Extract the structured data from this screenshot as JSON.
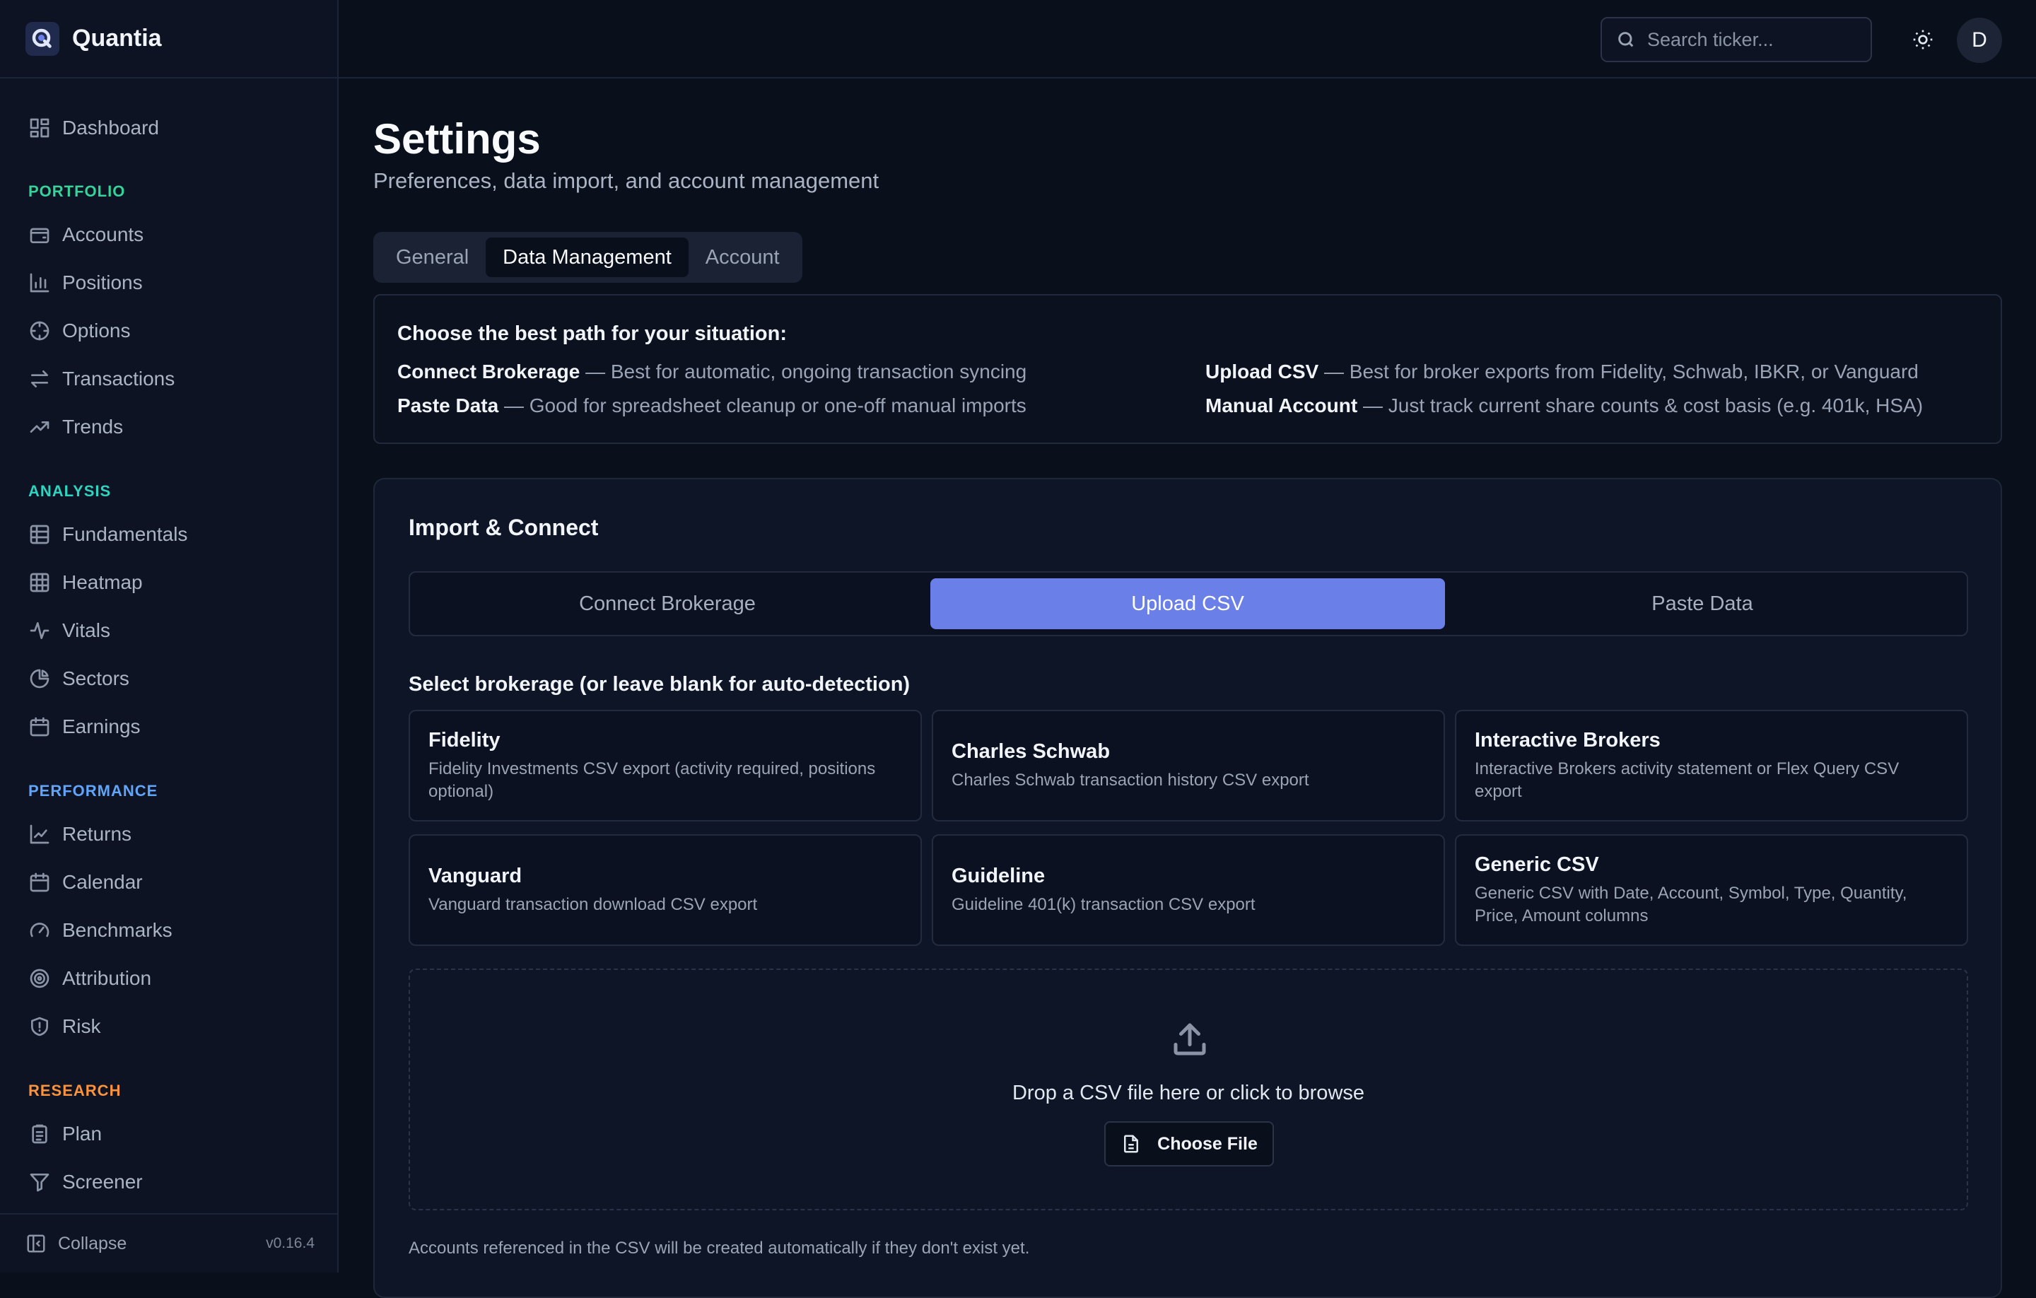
{
  "app": {
    "name": "Quantia",
    "version": "v0.16.4",
    "logo_icon": "q-logo-icon"
  },
  "colors": {
    "background": "#0a0f1c",
    "sidebar": "#0d1322",
    "accent": "#6b7fe8",
    "section_portfolio": "#34d399",
    "section_analysis": "#2dd4bf",
    "section_performance": "#60a5fa",
    "section_research": "#fb923c"
  },
  "sidebar": {
    "dashboard": "Dashboard",
    "sections": [
      {
        "label": "PORTFOLIO",
        "items": [
          "Accounts",
          "Positions",
          "Options",
          "Transactions",
          "Trends"
        ]
      },
      {
        "label": "ANALYSIS",
        "items": [
          "Fundamentals",
          "Heatmap",
          "Vitals",
          "Sectors",
          "Earnings"
        ]
      },
      {
        "label": "PERFORMANCE",
        "items": [
          "Returns",
          "Calendar",
          "Benchmarks",
          "Attribution",
          "Risk"
        ]
      },
      {
        "label": "RESEARCH",
        "items": [
          "Plan",
          "Screener"
        ]
      }
    ],
    "collapse_label": "Collapse"
  },
  "topbar": {
    "search_placeholder": "Search ticker...",
    "avatar_initial": "D"
  },
  "page": {
    "title": "Settings",
    "subtitle": "Preferences, data import, and account management",
    "tabs": [
      "General",
      "Data Management",
      "Account"
    ],
    "active_tab": "Data Management"
  },
  "guide": {
    "title": "Choose the best path for your situation:",
    "items": [
      {
        "name": "Connect Brokerage",
        "desc": " — Best for automatic, ongoing transaction syncing"
      },
      {
        "name": "Upload CSV",
        "desc": " — Best for broker exports from Fidelity, Schwab, IBKR, or Vanguard"
      },
      {
        "name": "Paste Data",
        "desc": " — Good for spreadsheet cleanup or one-off manual imports"
      },
      {
        "name": "Manual Account",
        "desc": " — Just track current share counts & cost basis (e.g. 401k, HSA)"
      }
    ]
  },
  "import": {
    "title": "Import & Connect",
    "modes": [
      "Connect Brokerage",
      "Upload CSV",
      "Paste Data"
    ],
    "active_mode": "Upload CSV",
    "select_label": "Select brokerage (or leave blank for auto-detection)",
    "brokers": [
      {
        "name": "Fidelity",
        "desc": "Fidelity Investments CSV export (activity required, positions optional)"
      },
      {
        "name": "Charles Schwab",
        "desc": "Charles Schwab transaction history CSV export"
      },
      {
        "name": "Interactive Brokers",
        "desc": "Interactive Brokers activity statement or Flex Query CSV export"
      },
      {
        "name": "Vanguard",
        "desc": "Vanguard transaction download CSV export"
      },
      {
        "name": "Guideline",
        "desc": "Guideline 401(k) transaction CSV export"
      },
      {
        "name": "Generic CSV",
        "desc": "Generic CSV with Date, Account, Symbol, Type, Quantity, Price, Amount columns"
      }
    ],
    "drop_text": "Drop a CSV file here or click to browse",
    "choose_file": "Choose File",
    "footnote": "Accounts referenced in the CSV will be created automatically if they don't exist yet."
  }
}
